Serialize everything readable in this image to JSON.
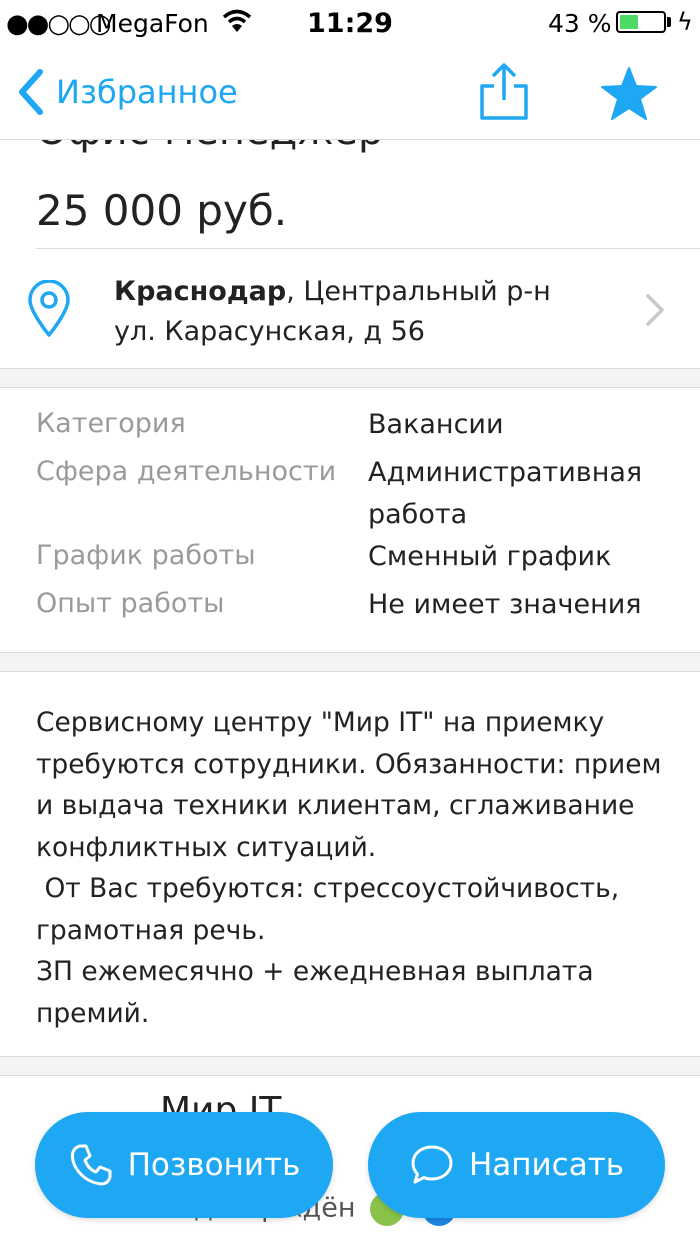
{
  "status_bar": {
    "signal": "●●○○○",
    "carrier": "MegaFon",
    "time": "11:29",
    "battery_percent": "43 %",
    "battery_level": 0.43,
    "battery_color": "#4cd964"
  },
  "nav": {
    "back_label": "Избранное",
    "accent_color": "#1ea7f2",
    "share_icon": "share-icon",
    "favorite_icon": "star-icon"
  },
  "listing": {
    "title_partial": "Офис-менеджер",
    "price": "25 000 руб."
  },
  "address": {
    "city": "Краснодар",
    "district": ", Центральный р-н",
    "street": "ул. Карасунская, д 56"
  },
  "params": [
    {
      "key": "Категория",
      "value": "Вакансии"
    },
    {
      "key": "Сфера деятельности",
      "value": "Административная работа"
    },
    {
      "key": "График работы",
      "value": "Сменный график"
    },
    {
      "key": "Опыт работы",
      "value": "Не имеет значения"
    }
  ],
  "description": "Сервисному центру \"Мир IT\" на приемку\nтребуются сотрудники. Обязанности: прием\nи выдача техники клиентам, сглаживание\nконфликтных ситуаций.\n От Вас требуются: стрессоустойчивость,\nграмотная речь.\nЗП ежемесячно + ежедневная выплата\nпремий.",
  "seller": {
    "name_partial": "Мир IT",
    "verified_partial": "подтверждён"
  },
  "actions": {
    "call_label": "Позвонить",
    "write_label": "Написать"
  }
}
